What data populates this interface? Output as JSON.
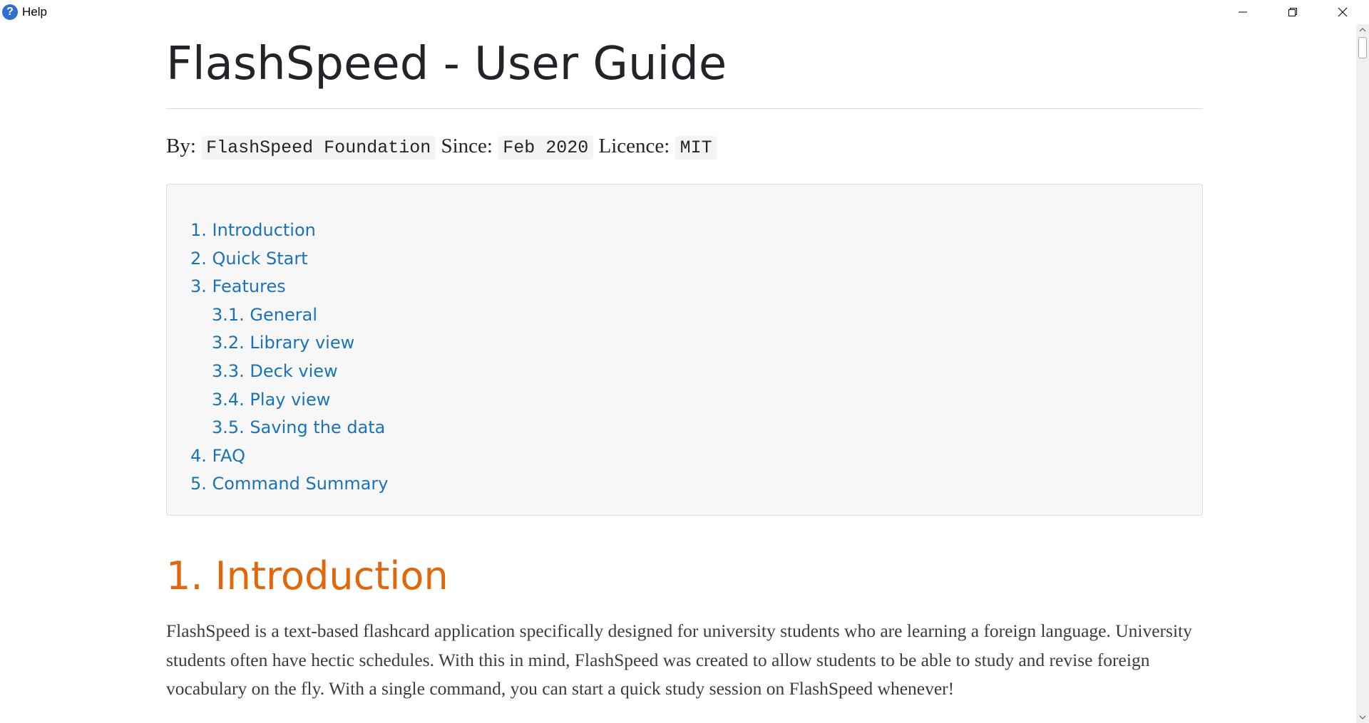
{
  "window": {
    "title": "Help",
    "icon": "help-question-icon",
    "icon_glyph": "?",
    "icon_color": "#2f6fcf"
  },
  "doc": {
    "title": "FlashSpeed - User Guide",
    "byline": {
      "by_label": "By:",
      "by_value": "FlashSpeed Foundation",
      "since_label": "Since:",
      "since_value": "Feb 2020",
      "licence_label": "Licence:",
      "licence_value": "MIT"
    },
    "toc": [
      {
        "label": "1. Introduction",
        "level": 1
      },
      {
        "label": "2. Quick Start",
        "level": 1
      },
      {
        "label": "3. Features",
        "level": 1
      },
      {
        "label": "3.1. General",
        "level": 2
      },
      {
        "label": "3.2. Library view",
        "level": 2
      },
      {
        "label": "3.3. Deck view",
        "level": 2
      },
      {
        "label": "3.4. Play view",
        "level": 2
      },
      {
        "label": "3.5. Saving the data",
        "level": 2
      },
      {
        "label": "4. FAQ",
        "level": 1
      },
      {
        "label": "5. Command Summary",
        "level": 1
      }
    ],
    "section_1": {
      "title": "1. Introduction",
      "text": "FlashSpeed is a text-based flashcard application specifically designed for university students who are learning a foreign language. University students often have hectic schedules. With this in mind, FlashSpeed was created to allow students to be able to study and revise foreign vocabulary on the fly. With a single command, you can start a quick study session on FlashSpeed whenever!"
    }
  },
  "colors": {
    "link": "#1a73b8",
    "section_heading": "#e0670c",
    "title_text": "#212529"
  }
}
